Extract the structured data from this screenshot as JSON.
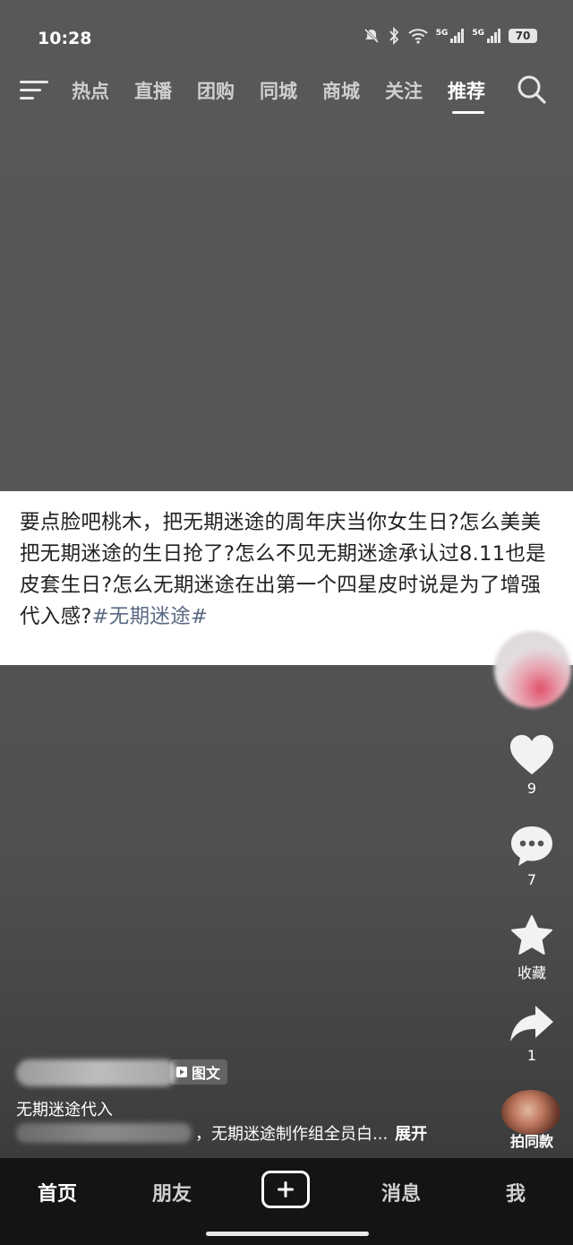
{
  "status": {
    "time": "10:28",
    "signal1": "5G",
    "signal2": "5G",
    "battery": "70"
  },
  "topnav": {
    "tabs": [
      {
        "label": "热点"
      },
      {
        "label": "直播"
      },
      {
        "label": "团购"
      },
      {
        "label": "同城"
      },
      {
        "label": "商城"
      },
      {
        "label": "关注"
      },
      {
        "label": "推荐"
      }
    ],
    "active_tab": "推荐"
  },
  "post": {
    "text": "要点脸吧桃木，把无期迷途的周年庆当你女生日?怎么美美把无期迷途的生日抢了?怎么不见无期迷途承认过8.11也是皮套生日?怎么无期迷途在出第一个四星皮时说是为了增强代入感?",
    "hashtag": "#无期迷途#"
  },
  "actions": {
    "likes": "9",
    "comments": "7",
    "favorite_label": "收藏",
    "shares": "1"
  },
  "info": {
    "badge_label": "图文",
    "title": "无期迷途代入",
    "desc_visible": "，无期迷途制作组全员白...",
    "expand_label": "展开",
    "music_label": "拍同款"
  },
  "bottomnav": {
    "home": "首页",
    "friends": "朋友",
    "messages": "消息",
    "me": "我"
  },
  "colors": {
    "hashtag": "#5a6a84",
    "card_bg": "#ffffff",
    "nav_bg": "#141414"
  }
}
